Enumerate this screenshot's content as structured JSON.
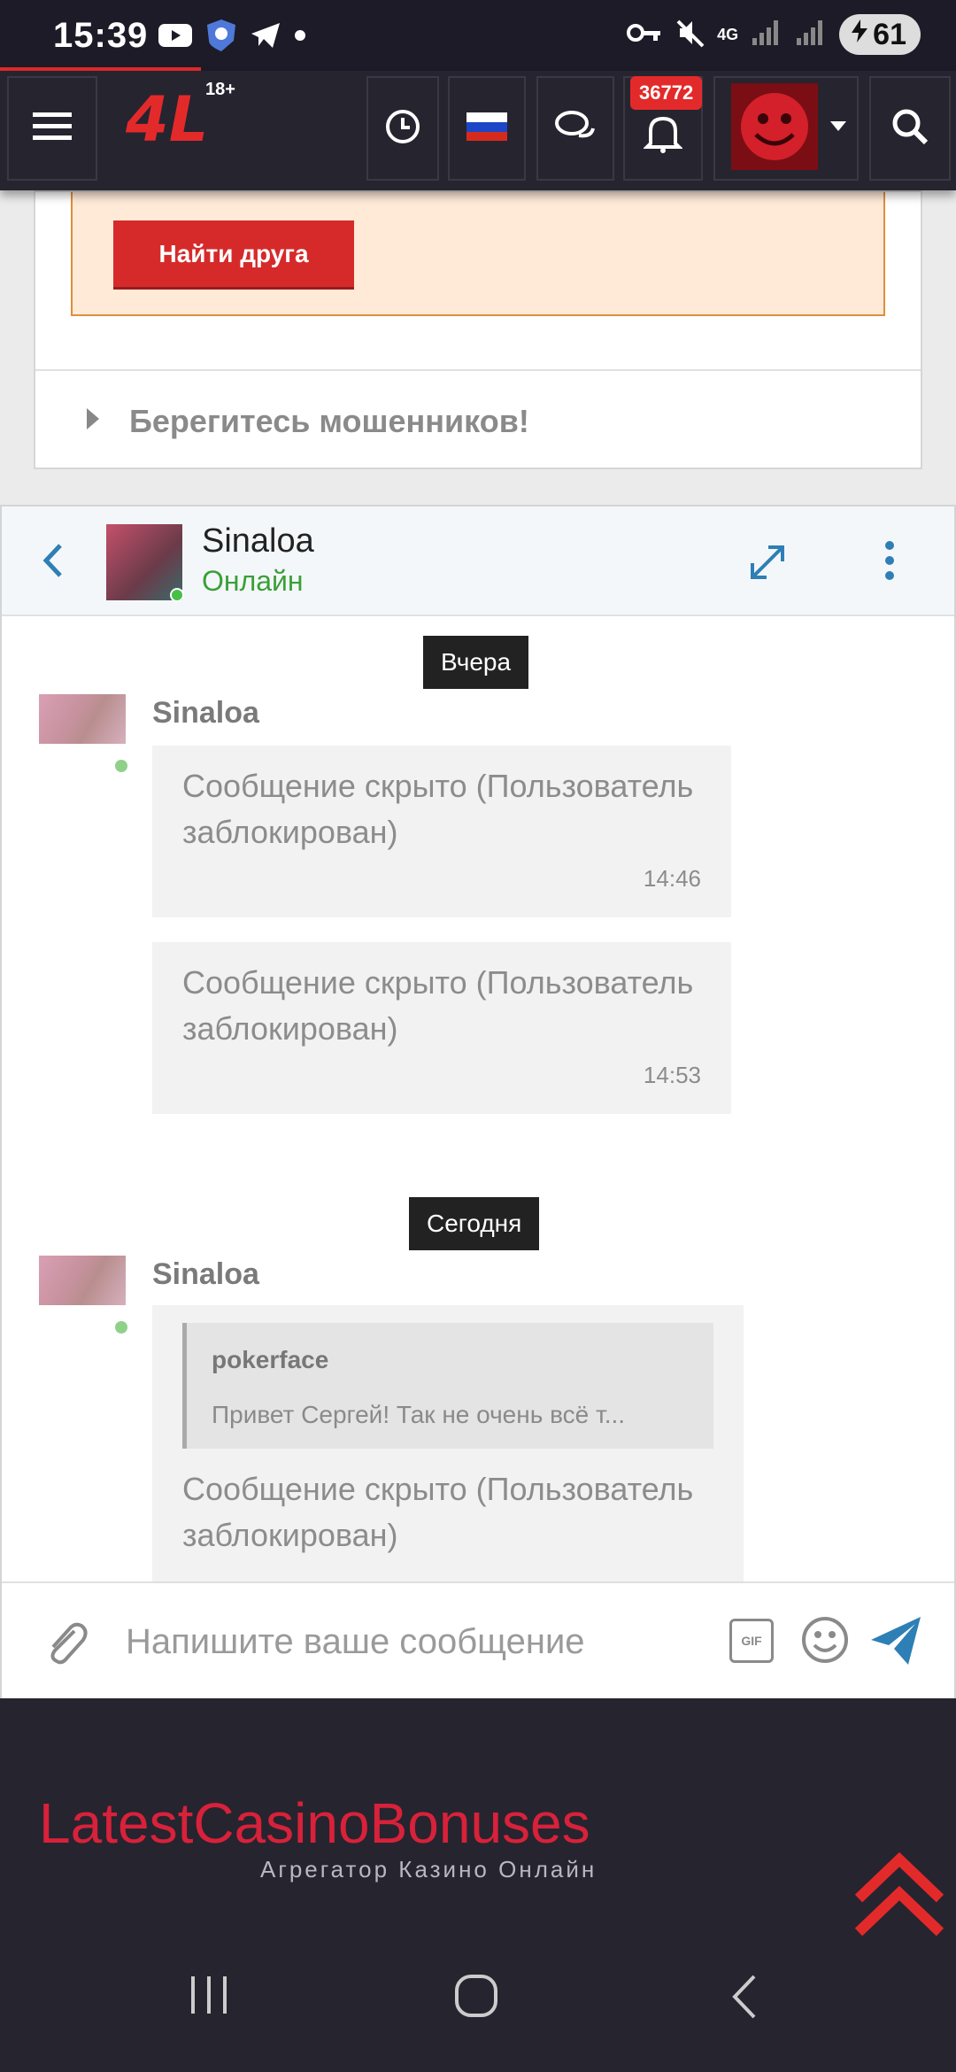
{
  "status_bar": {
    "time": "15:39",
    "network": "4G",
    "battery": "61",
    "icons_left": [
      "youtube-icon",
      "shield-icon",
      "telegram-icon",
      "dot-icon"
    ],
    "icons_right": [
      "key-icon",
      "mute-icon",
      "signal-icon",
      "battery-icon"
    ]
  },
  "header": {
    "logo": "4L",
    "age_label": "18+",
    "notification_count": "36772",
    "page_progress": 0.21,
    "buttons": [
      "menu-icon",
      "history-icon",
      "language-flag-ru",
      "chat-icon",
      "bell-icon",
      "avatar-menu",
      "search-icon"
    ]
  },
  "top_content": {
    "find_friend_label": "Найти друга",
    "beware_label": "Берегитесь мошенников!"
  },
  "chat": {
    "contact_name": "Sinaloa",
    "contact_status": "Онлайн",
    "groups": [
      {
        "date": "Вчера",
        "author": "Sinaloa",
        "messages": [
          {
            "text": "Сообщение скрыто (Пользователь заблокирован)",
            "time": "14:46"
          },
          {
            "text": "Сообщение скрыто (Пользователь заблокирован)",
            "time": "14:53"
          }
        ]
      },
      {
        "date": "Сегодня",
        "author": "Sinaloa",
        "messages": [
          {
            "quote_author": "pokerface",
            "quote_text": "Привет Сергей! Так не очень всё т...",
            "text": "Сообщение скрыто (Пользователь заблокирован)"
          }
        ]
      }
    ],
    "composer": {
      "placeholder": "Напишите ваше сообщение",
      "gif_label": "GIF"
    }
  },
  "footer": {
    "brand": "LatestCasinoBonuses",
    "tagline": "Агрегатор Казино Онлайн"
  },
  "colors": {
    "accent": "#e32a2a",
    "header_bg": "#26242f",
    "online": "#3aa037",
    "link": "#2e7fb5"
  }
}
